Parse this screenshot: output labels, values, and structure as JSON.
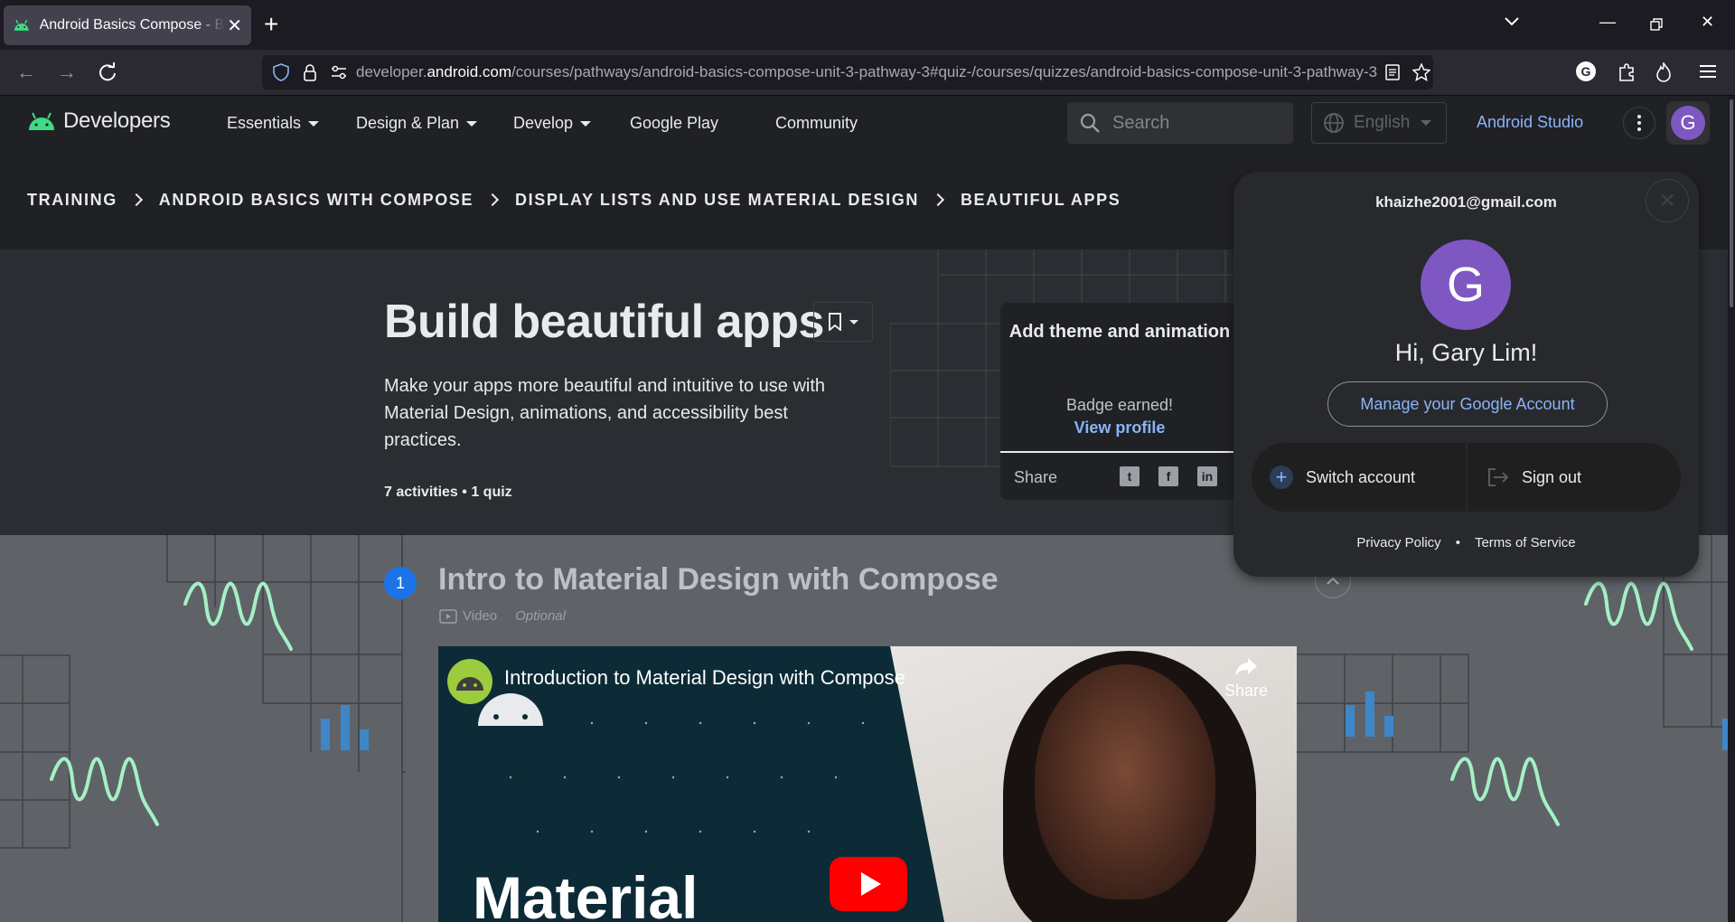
{
  "browser": {
    "tab_title": "Android Basics Compose - Build beautiful apps",
    "url_prefix": "developer.",
    "url_domain": "android.com",
    "url_path": "/courses/pathways/android-basics-compose-unit-3-pathway-3#quiz-/courses/quizzes/android-basics-compose-unit-3-pathway-3"
  },
  "site": {
    "logo_text": "Developers",
    "nav": [
      {
        "label": "Essentials"
      },
      {
        "label": "Design & Plan"
      },
      {
        "label": "Develop"
      },
      {
        "label": "Google Play"
      },
      {
        "label": "Community"
      }
    ],
    "search_placeholder": "Search",
    "language": "English",
    "studio_link": "Android Studio",
    "avatar_letter": "G"
  },
  "breadcrumb": [
    "TRAINING",
    "ANDROID BASICS WITH COMPOSE",
    "DISPLAY LISTS AND USE MATERIAL DESIGN",
    "BEAUTIFUL APPS"
  ],
  "hero": {
    "title": "Build beautiful apps",
    "description": "Make your apps more beautiful and intuitive to use with Material Design, animations, and accessibility best practices.",
    "meta": "7 activities • 1 quiz"
  },
  "badge_card": {
    "title": "Add theme and animation",
    "earned": "Badge earned!",
    "view_profile": "View profile",
    "share": "Share"
  },
  "step": {
    "number": "1",
    "title": "Intro to Material Design with Compose",
    "type": "Video",
    "optional": "Optional"
  },
  "video": {
    "title": "Introduction to Material Design with Compose",
    "share": "Share",
    "overlay_text": "Material"
  },
  "account_popup": {
    "email": "khaizhe2001@gmail.com",
    "avatar_letter": "G",
    "greeting": "Hi, Gary Lim!",
    "manage": "Manage your Google Account",
    "switch": "Switch account",
    "signout": "Sign out",
    "privacy": "Privacy Policy",
    "terms": "Terms of Service"
  },
  "colors": {
    "accent_blue": "#8ab4f8",
    "avatar_purple": "#7e57c2",
    "android_green": "#3ddc84"
  }
}
